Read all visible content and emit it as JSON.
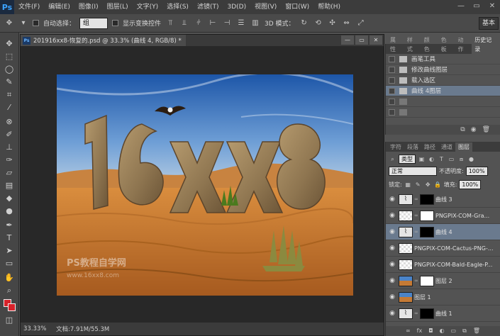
{
  "app": {
    "logo": "Ps"
  },
  "menu": [
    "文件(F)",
    "编辑(E)",
    "图像(I)",
    "图层(L)",
    "文字(Y)",
    "选择(S)",
    "滤镜(T)",
    "3D(D)",
    "视图(V)",
    "窗口(W)",
    "帮助(H)"
  ],
  "window_controls": [
    "—",
    "▭",
    "✕"
  ],
  "options": {
    "auto_select_label": "自动选择：",
    "auto_select_value": "组",
    "show_transform_label": "显示变换控件",
    "mode_3d_label": "3D 模式：",
    "workspace": "基本"
  },
  "document": {
    "title": "201916xx8-恢复的.psd @ 33.3% (曲线 4, RGB/8) *",
    "zoom": "33.33%",
    "info": "文档:7.91M/55.3M",
    "artwork_text": "16xx8",
    "watermark_title": "PS教程自学网",
    "watermark_url": "www.16xx8.com"
  },
  "history": {
    "tabs": [
      "属性",
      "样式",
      "颜色",
      "色板",
      "动作",
      "历史记录"
    ],
    "active_tab": "历史记录",
    "items": [
      {
        "label": "画笔工具",
        "state": "normal"
      },
      {
        "label": "修改曲线图层",
        "state": "normal"
      },
      {
        "label": "载入选区",
        "state": "normal"
      },
      {
        "label": "曲线 4图层",
        "state": "active"
      },
      {
        "label": "",
        "state": "dim"
      },
      {
        "label": "",
        "state": "dim"
      }
    ]
  },
  "layers": {
    "tabs": [
      "字符",
      "段落",
      "路径",
      "通道",
      "图层"
    ],
    "active_tab": "图层",
    "filter_kind": "类型",
    "blend_mode": "正常",
    "opacity_label": "不透明度:",
    "opacity_value": "100%",
    "lock_label": "锁定:",
    "fill_label": "填充:",
    "fill_value": "100%",
    "items": [
      {
        "name": "曲线 3",
        "kind": "adjustment",
        "active": false
      },
      {
        "name": "PNGPIX-COM-Gra...",
        "kind": "image-mask",
        "active": false
      },
      {
        "name": "曲线 4",
        "kind": "adjustment",
        "active": true
      },
      {
        "name": "PNGPIX-COM-Cactus-PNG-...",
        "kind": "image",
        "active": false
      },
      {
        "name": "PNGPIX-COM-Bald-Eagle-P...",
        "kind": "image",
        "active": false
      },
      {
        "name": "图层 2",
        "kind": "photo-mask",
        "active": false
      },
      {
        "name": "图层 1",
        "kind": "photo",
        "active": false
      },
      {
        "name": "曲线 1",
        "kind": "adjustment-text",
        "active": false
      }
    ]
  },
  "colors": {
    "accent": "#6a7a8e",
    "foreground_swatch": "#d8222a",
    "background_swatch": "#d8222a"
  }
}
